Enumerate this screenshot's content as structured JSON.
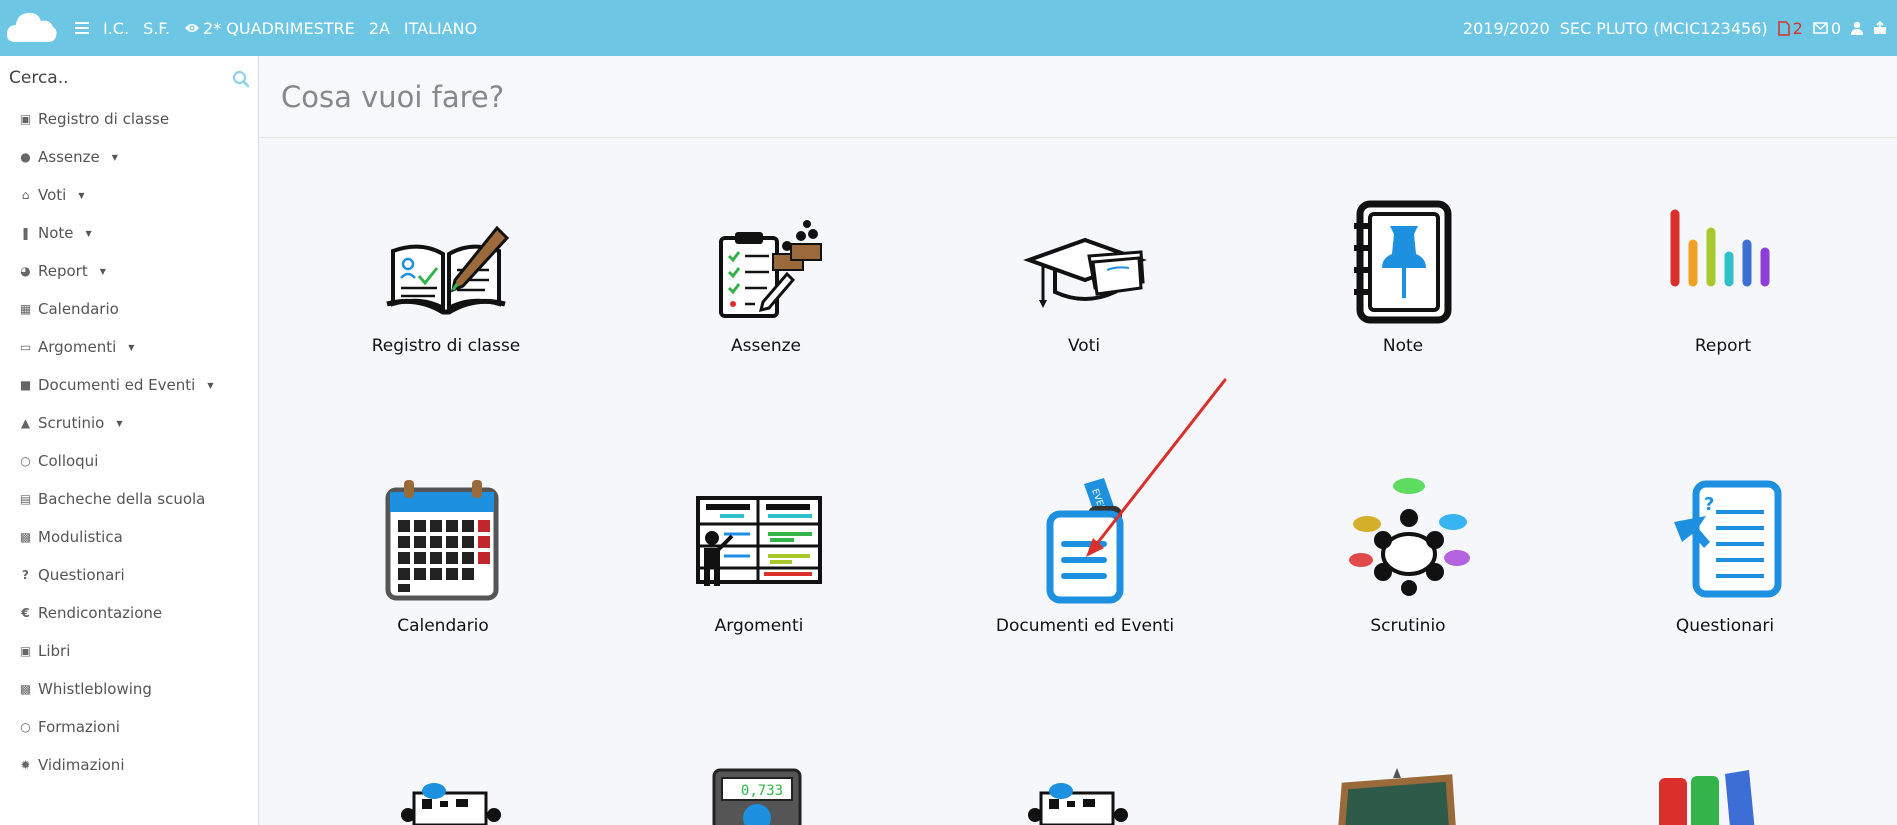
{
  "topbar": {
    "school": "I.C.",
    "user": "S.F.",
    "period": "2* QUADRIMESTRE",
    "class": "2A",
    "subject": "ITALIANO",
    "year": "2019/2020",
    "school_name": "SEC PLUTO (MCIC123456)",
    "docs_count": "2",
    "mail_count": "0"
  },
  "search": {
    "placeholder": "Cerca.."
  },
  "sidebar": {
    "items": [
      {
        "label": "Registro di classe",
        "icon": "book-icon"
      },
      {
        "label": "Assenze",
        "icon": "user-icon"
      },
      {
        "label": "Voti",
        "icon": "bank-icon"
      },
      {
        "label": "Note",
        "icon": "pin-icon"
      },
      {
        "label": "Report",
        "icon": "pie-chart-icon"
      },
      {
        "label": "Calendario",
        "icon": "calendar-icon"
      },
      {
        "label": "Argomenti",
        "icon": "folder-icon"
      },
      {
        "label": "Documenti ed Eventi",
        "icon": "archive-icon"
      },
      {
        "label": "Scrutinio",
        "icon": "graduation-cap-icon"
      },
      {
        "label": "Colloqui",
        "icon": "comments-icon"
      },
      {
        "label": "Bacheche della scuola",
        "icon": "list-icon"
      },
      {
        "label": "Modulistica",
        "icon": "print-icon"
      },
      {
        "label": "Questionari",
        "icon": "question-icon"
      },
      {
        "label": "Rendicontazione",
        "icon": "euro-icon"
      },
      {
        "label": "Libri",
        "icon": "book-icon"
      },
      {
        "label": "Whistleblowing",
        "icon": "lock-icon"
      },
      {
        "label": "Formazioni",
        "icon": "comments-icon"
      },
      {
        "label": "Vidimazioni",
        "icon": "gear-icon"
      }
    ]
  },
  "main": {
    "title": "Cosa vuoi fare?",
    "tiles": [
      {
        "label": "Registro di classe",
        "icon": "open-book-pencil-icon"
      },
      {
        "label": "Assenze",
        "icon": "clipboard-checklist-icon"
      },
      {
        "label": "Voti",
        "icon": "graduation-cap-papers-icon"
      },
      {
        "label": "Note",
        "icon": "notebook-pin-icon"
      },
      {
        "label": "Report",
        "icon": "bar-chart-icon"
      },
      {
        "label": "Calendario",
        "icon": "calendar-icon"
      },
      {
        "label": "Argomenti",
        "icon": "teacher-board-icon"
      },
      {
        "label": "Documenti ed Eventi",
        "icon": "documents-events-icon"
      },
      {
        "label": "Scrutinio",
        "icon": "meeting-table-icon"
      },
      {
        "label": "Questionari",
        "icon": "questionnaire-icon"
      }
    ]
  },
  "colors": {
    "topbar": "#6ec6e5",
    "accent_blue": "#1e90e0",
    "alert_red": "#d9302b"
  }
}
